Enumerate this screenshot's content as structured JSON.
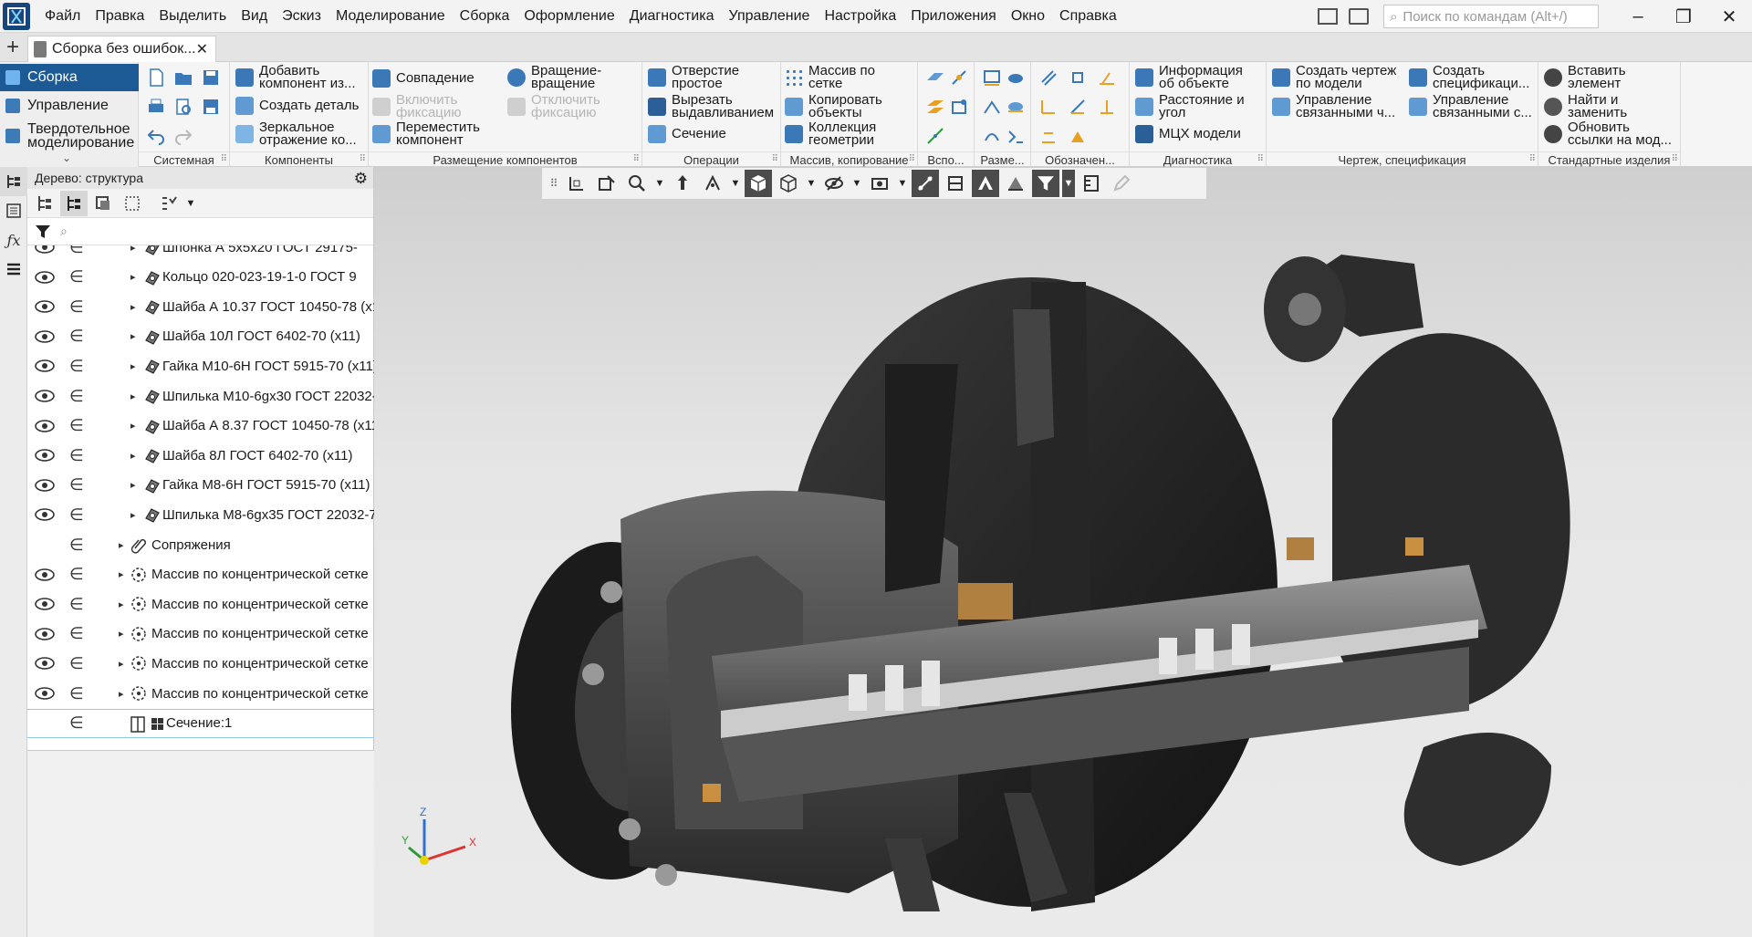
{
  "window": {
    "menu": [
      "Файл",
      "Правка",
      "Выделить",
      "Вид",
      "Эскиз",
      "Моделирование",
      "Сборка",
      "Оформление",
      "Диагностика",
      "Управление",
      "Настройка",
      "Приложения",
      "Окно",
      "Справка"
    ],
    "search_placeholder": "Поиск по командам (Alt+/)",
    "controls": [
      "–",
      "❐",
      "✕"
    ]
  },
  "tab": {
    "add": "+",
    "title": "Сборка без ошибок...",
    "close": "✕"
  },
  "modes": {
    "items": [
      {
        "label": "Сборка"
      },
      {
        "label": "Управление"
      },
      {
        "label": "Твердотельное моделирование"
      }
    ],
    "chevron": "⌄"
  },
  "ribbon": {
    "panels": [
      {
        "title": "Системная"
      },
      {
        "title": "Компоненты",
        "buttons": [
          "Добавить компонент из...",
          "Создать деталь",
          "Зеркальное отражение ко..."
        ]
      },
      {
        "title": "Размещение компонентов",
        "buttons": [
          "Совпадение",
          "Включить фиксацию",
          "Переместить компонент",
          "Вращение-вращение",
          "Отключить фиксацию"
        ]
      },
      {
        "title": "Операции",
        "buttons": [
          "Отверстие простое",
          "Вырезать выдавливанием",
          "Сечение"
        ]
      },
      {
        "title": "Массив, копирование",
        "buttons": [
          "Массив по сетке",
          "Копировать объекты",
          "Коллекция геометрии"
        ]
      },
      {
        "title": "Вспо..."
      },
      {
        "title": "Разме..."
      },
      {
        "title": "Обозначен..."
      },
      {
        "title": "Диагностика",
        "buttons": [
          "Информация об объекте",
          "Расстояние и угол",
          "МЦХ модели"
        ]
      },
      {
        "title": "Чертеж, спецификация",
        "buttons": [
          "Создать чертеж по модели",
          "Управление связанными ч...",
          "Создать спецификаци...",
          "Управление связанными с..."
        ]
      },
      {
        "title": "Стандартные изделия",
        "buttons": [
          "Вставить элемент",
          "Найти и заменить",
          "Обновить ссылки на мод..."
        ]
      }
    ]
  },
  "tree": {
    "header": "Дерево: структура",
    "rows": [
      {
        "label": "Шпонка А 5х5х20 ГОСТ 29175-"
      },
      {
        "label": "Кольцо 020-023-19-1-0 ГОСТ 9"
      },
      {
        "label": "Шайба А 10.37 ГОСТ 10450-78 (х1"
      },
      {
        "label": "Шайба 10Л ГОСТ 6402-70 (х11)"
      },
      {
        "label": "Гайка М10-6Н ГОСТ 5915-70 (х11)"
      },
      {
        "label": "Шпилька М10-6gх30 ГОСТ 22032-"
      },
      {
        "label": "Шайба А 8.37 ГОСТ 10450-78 (х11"
      },
      {
        "label": "Шайба 8Л ГОСТ 6402-70 (х11)"
      },
      {
        "label": "Гайка М8-6Н ГОСТ 5915-70 (х11)"
      },
      {
        "label": "Шпилька М8-6gх35 ГОСТ 22032-7"
      },
      {
        "label": "Сопряжения"
      },
      {
        "label": "Массив по концентрической сетке"
      },
      {
        "label": "Массив по концентрической сетке"
      },
      {
        "label": "Массив по концентрической сетке"
      },
      {
        "label": "Массив по концентрической сетке"
      },
      {
        "label": "Массив по концентрической сетке"
      },
      {
        "label": "Сечение:1"
      }
    ]
  },
  "triad": {
    "x": "X",
    "y": "Y",
    "z": "Z"
  },
  "colors": {
    "accent": "#1c5a95",
    "axis_x": "#d33",
    "axis_y": "#2a9a3a",
    "axis_z": "#2f6fd6",
    "origin": "#e8d400"
  }
}
